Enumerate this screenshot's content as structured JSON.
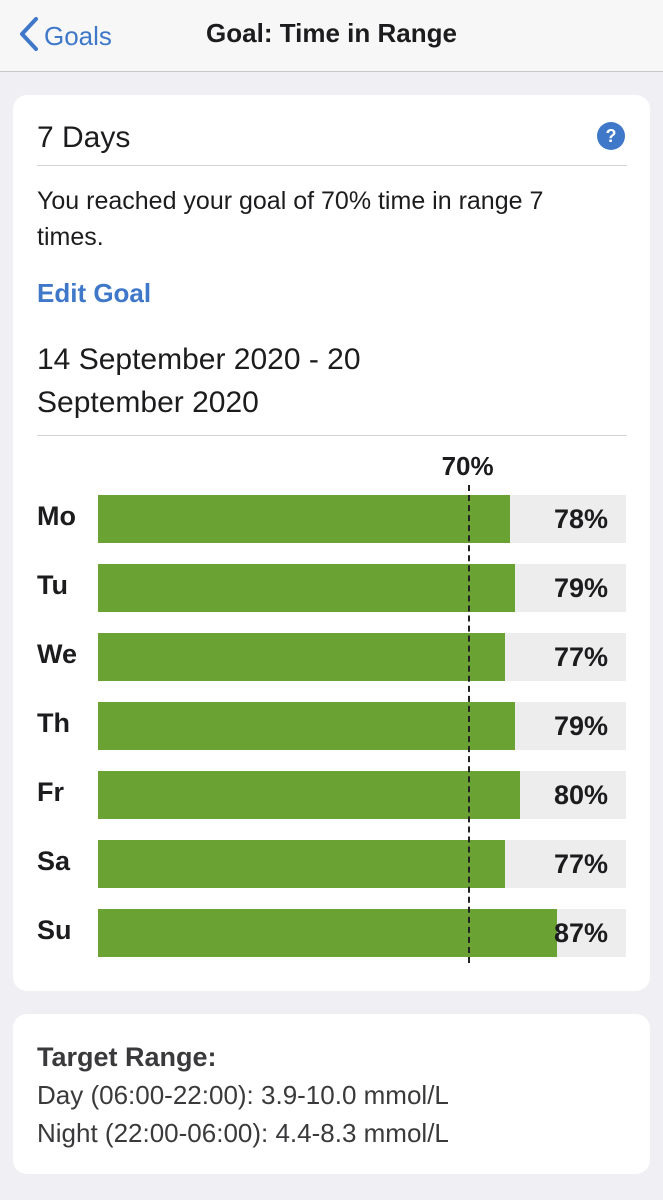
{
  "nav": {
    "back_label": "Goals",
    "title": "Goal: Time in Range"
  },
  "summary": {
    "period": "7 Days",
    "help_label": "?",
    "message": "You reached your goal of 70% time in range 7 times.",
    "edit_goal_label": "Edit Goal",
    "date_range": "14 September 2020 - 20 September 2020"
  },
  "colors": {
    "accent": "#3f78c9",
    "bar_fill": "#6aa334",
    "bar_track": "#ededed"
  },
  "chart_data": {
    "type": "bar",
    "orientation": "horizontal",
    "goal": 70,
    "goal_label": "70%",
    "xlim": [
      0,
      100
    ],
    "categories": [
      "Mo",
      "Tu",
      "We",
      "Th",
      "Fr",
      "Sa",
      "Su"
    ],
    "values": [
      78,
      79,
      77,
      79,
      80,
      77,
      87
    ],
    "value_labels": [
      "78%",
      "79%",
      "77%",
      "79%",
      "80%",
      "77%",
      "87%"
    ]
  },
  "target_range": {
    "title": "Target Range:",
    "day": "Day (06:00-22:00): 3.9-10.0 mmol/L",
    "night": "Night (22:00-06:00): 4.4-8.3 mmol/L"
  }
}
